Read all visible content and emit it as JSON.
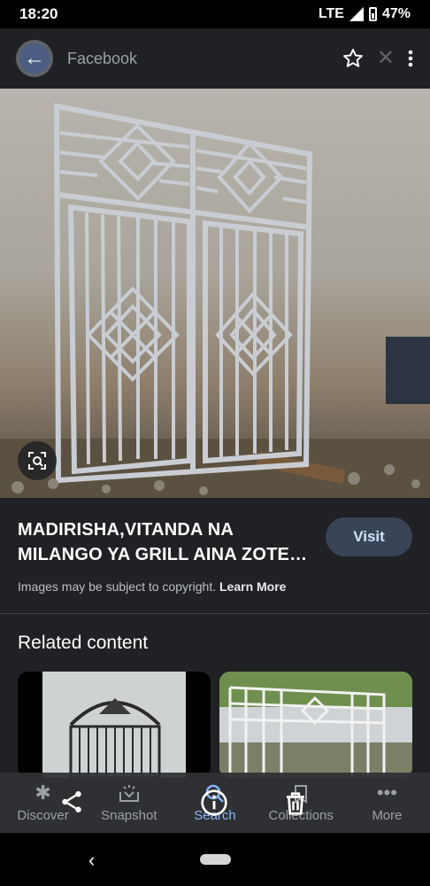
{
  "status_bar": {
    "time": "18:20",
    "network": "LTE",
    "battery": "47%"
  },
  "top_bar": {
    "site_name": "Facebook",
    "icons": [
      "back-arrow-icon",
      "facebook-logo-icon",
      "star-icon",
      "close-icon",
      "more-vert-icon"
    ]
  },
  "result": {
    "title": "MADIRISHA,VITANDA NA MILANGO YA GRILL AINA ZOTE…",
    "visit_label": "Visit",
    "copyright_text": "Images may be subject to copyright.",
    "learn_more_label": "Learn More"
  },
  "related": {
    "heading": "Related content"
  },
  "bottom_nav": {
    "items": [
      {
        "label": "Discover",
        "icon": "asterisk-icon"
      },
      {
        "label": "Snapshot",
        "icon": "snapshot-icon"
      },
      {
        "label": "Search",
        "icon": "search-icon",
        "active": true
      },
      {
        "label": "Collections",
        "icon": "bookmark-icon"
      },
      {
        "label": "More",
        "icon": "more-horiz-icon"
      }
    ],
    "overlay_icons": [
      "share-icon",
      "info-icon",
      "delete-icon"
    ]
  },
  "colors": {
    "background": "#202124",
    "accent": "#8ab4f8",
    "visit_button": "#394457"
  }
}
